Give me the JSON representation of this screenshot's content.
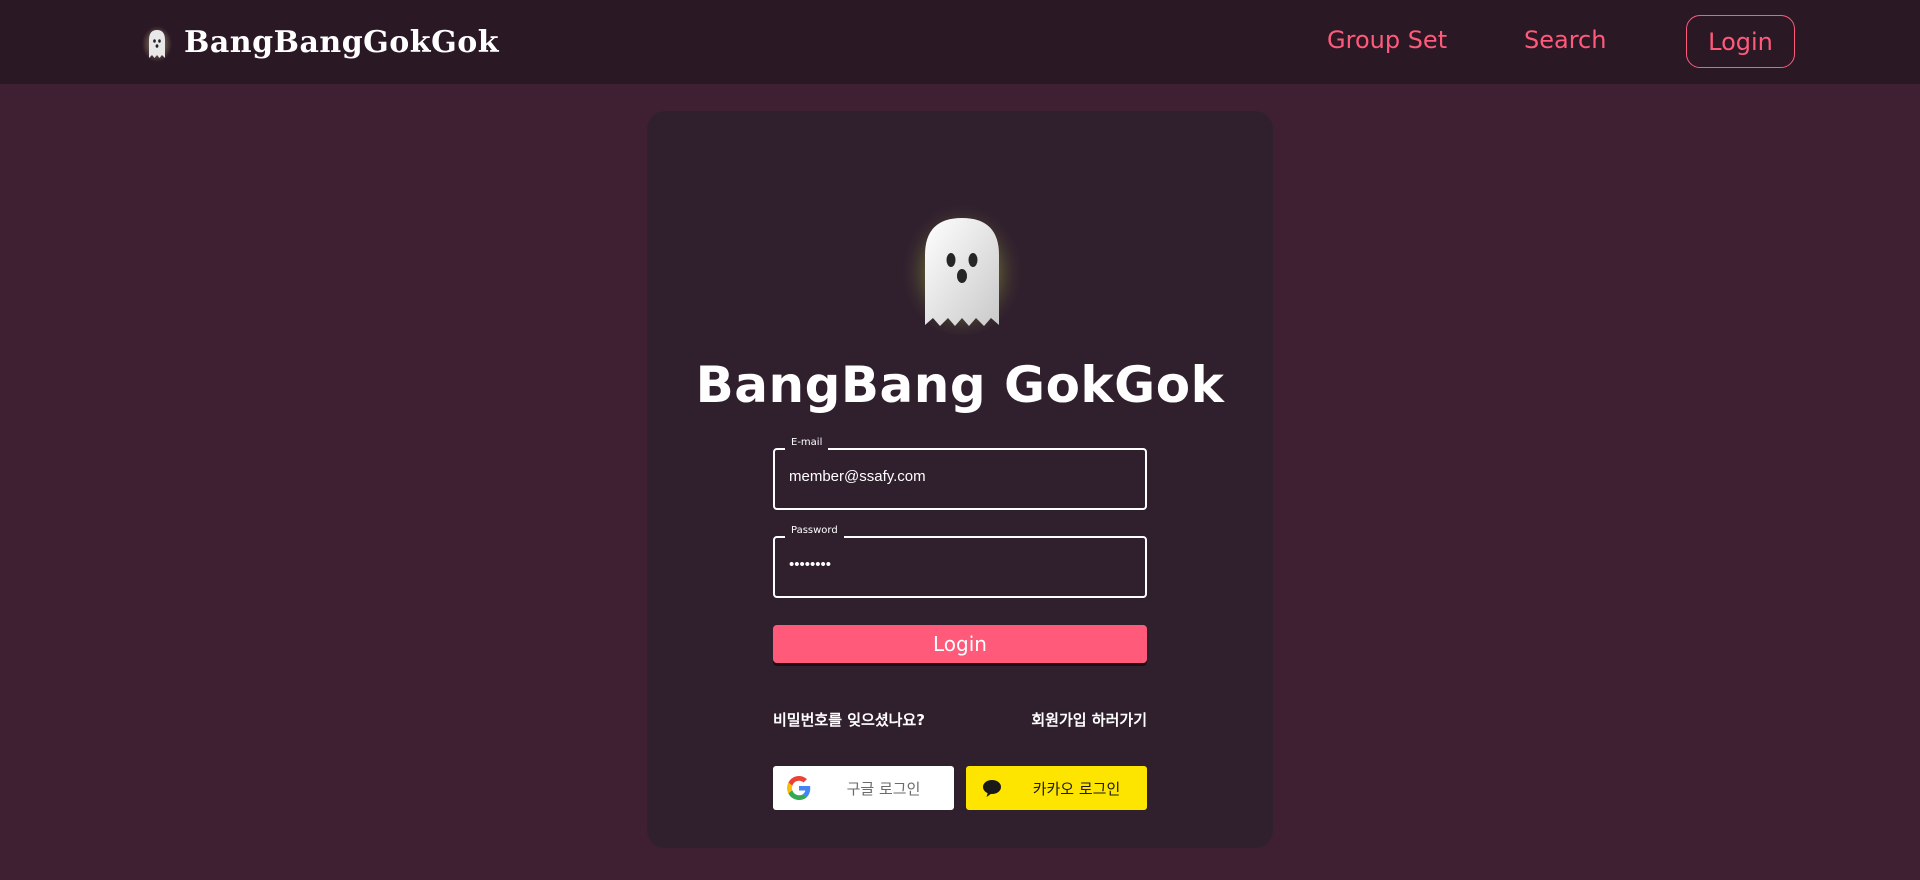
{
  "header": {
    "brand_name": "BangBangGokGok",
    "nav": {
      "group_set": "Group Set",
      "search": "Search",
      "login": "Login"
    }
  },
  "login_card": {
    "title": "BangBang GokGok",
    "email": {
      "label": "E-mail",
      "value": "member@ssafy.com"
    },
    "password": {
      "label": "Password",
      "value": "••••••••"
    },
    "login_button": "Login",
    "forgot_password": "비밀번호를 잊으셨나요?",
    "signup": "회원가입 하러가기",
    "google_login": "구글 로그인",
    "kakao_login": "카카오 로그인"
  },
  "colors": {
    "page_bg": "#3f2033",
    "header_bg": "#2b1825",
    "card_bg": "#30202e",
    "accent": "#ff5a7a",
    "kakao": "#fee500"
  },
  "icons": [
    "ghost-logo-icon",
    "ghost-hero-icon",
    "google-icon",
    "kakao-chat-icon"
  ]
}
